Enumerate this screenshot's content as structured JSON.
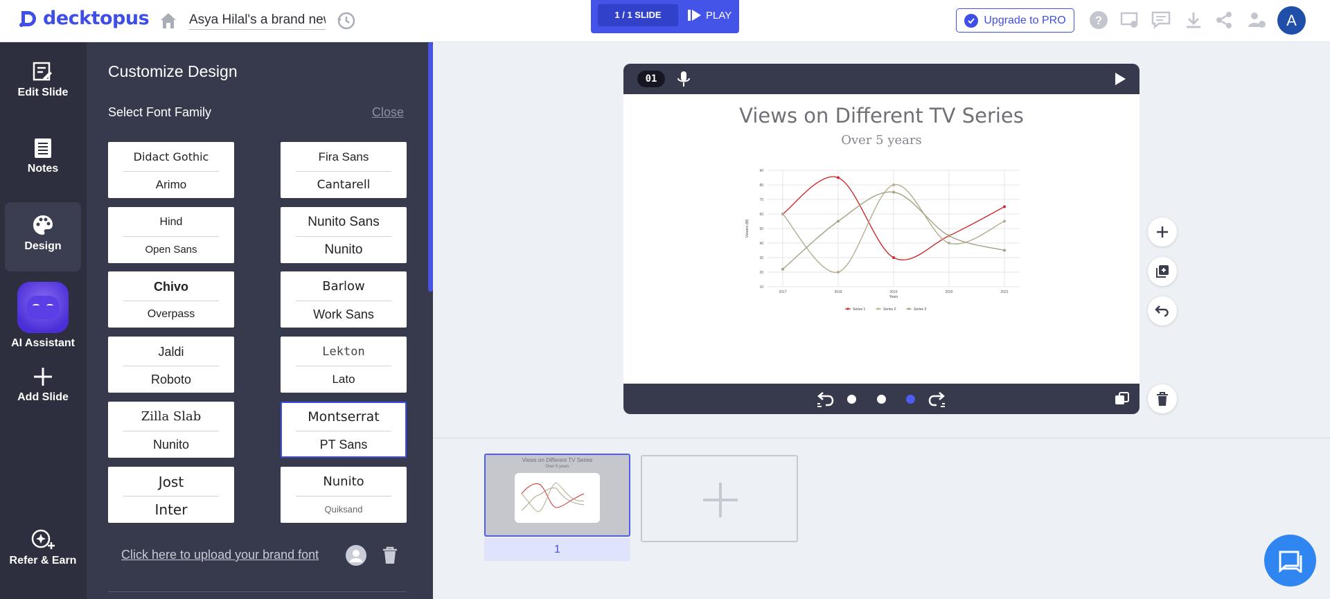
{
  "app": {
    "logo_text": "decktopus",
    "doc_title": "Asya Hilal's a brand new",
    "slide_count": "1 / 1 SLIDE",
    "play_label": "PLAY",
    "upgrade_label": "Upgrade to PRO",
    "avatar_initial": "A",
    "brand_color": "#3f4ee6"
  },
  "rail": {
    "items": [
      {
        "label": "Edit Slide",
        "icon": "edit-slide-icon"
      },
      {
        "label": "Notes",
        "icon": "notes-icon"
      },
      {
        "label": "Design",
        "icon": "palette-icon"
      },
      {
        "label": "AI Assistant",
        "icon": "ai-assistant-avatar"
      },
      {
        "label": "Add Slide",
        "icon": "plus-icon"
      }
    ],
    "refer_label": "Refer & Earn"
  },
  "panel": {
    "title": "Customize Design",
    "subtitle": "Select Font Family",
    "close_label": "Close",
    "upload_label": "Click here to upload your brand font",
    "fonts": [
      {
        "top": "Didact Gothic",
        "bottom": "Arimo"
      },
      {
        "top": "Fira Sans",
        "bottom": "Cantarell"
      },
      {
        "top": "Hind",
        "bottom": "Open Sans"
      },
      {
        "top": "Nunito Sans",
        "bottom": "Nunito"
      },
      {
        "top": "Chivo",
        "bottom": "Overpass"
      },
      {
        "top": "Barlow",
        "bottom": "Work Sans"
      },
      {
        "top": "Jaldi",
        "bottom": "Roboto"
      },
      {
        "top": "Lekton",
        "bottom": "Lato"
      },
      {
        "top": "Zilla Slab",
        "bottom": "Nunito"
      },
      {
        "top": "Montserrat",
        "bottom": "PT Sans",
        "selected": true
      },
      {
        "top": "Jost",
        "bottom": "Inter"
      },
      {
        "top": "Nunito",
        "bottom": "Quiksand"
      }
    ]
  },
  "slide": {
    "number": "01",
    "title": "Views on Different TV Series",
    "subtitle": "Over 5 years",
    "nav_dots": 3,
    "active_dot": 2
  },
  "chart_data": {
    "type": "line",
    "title": "",
    "xlabel": "Years",
    "ylabel": "Viewers (M)",
    "categories": [
      "2017",
      "2018",
      "2019",
      "2020",
      "2021"
    ],
    "yticks": [
      10,
      20,
      30,
      40,
      50,
      60,
      70,
      80,
      90
    ],
    "ylim": [
      10,
      90
    ],
    "grid": true,
    "legend": "bottom",
    "series": [
      {
        "name": "Series 1",
        "values": [
          60,
          85,
          30,
          45,
          65
        ],
        "color": "#cc2a2a"
      },
      {
        "name": "Series 2",
        "values": [
          60,
          20,
          80,
          40,
          55
        ],
        "color": "#b5ab8d"
      },
      {
        "name": "Series 3",
        "values": [
          22,
          55,
          75,
          45,
          35
        ],
        "color": "#a8a085"
      }
    ]
  },
  "thumbnail": {
    "title": "Views on Different TV Series",
    "subtitle": "Over 5 years",
    "label": "1"
  }
}
